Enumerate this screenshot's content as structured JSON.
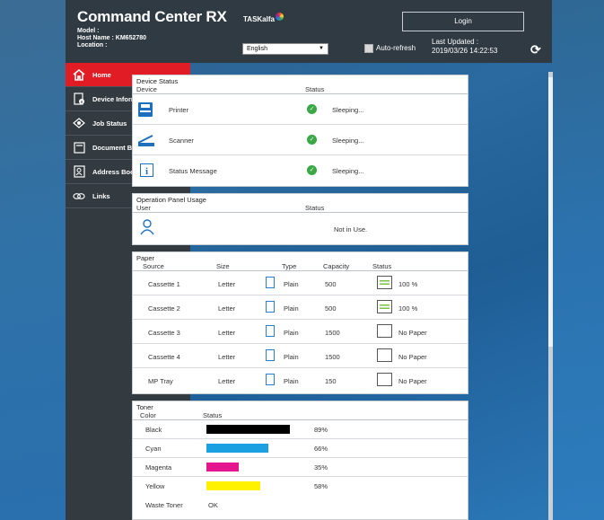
{
  "header": {
    "app_title": "Command Center RX",
    "model_label": "Model :",
    "model_value": "",
    "host_label": "Host Name : KM652780",
    "location_label": "Location :",
    "brand": "TASKalfa",
    "language": "English",
    "auto_refresh": "Auto-refresh",
    "login": "Login",
    "last_updated_label": "Last Updated :",
    "last_updated_value": "2019/03/26 14:22:53"
  },
  "sidebar": {
    "items": [
      {
        "label": "Home",
        "icon": "home-icon",
        "active": true
      },
      {
        "label": "Device Information",
        "icon": "device-info-icon"
      },
      {
        "label": "Job Status",
        "icon": "job-status-icon"
      },
      {
        "label": "Document Box",
        "icon": "document-box-icon"
      },
      {
        "label": "Address Book",
        "icon": "address-book-icon"
      },
      {
        "label": "Links",
        "icon": "links-icon"
      }
    ]
  },
  "device_status": {
    "title": "Device Status",
    "col_device": "Device",
    "col_status": "Status",
    "rows": [
      {
        "device": "Printer",
        "icon": "printer-icon",
        "status": "Sleeping..."
      },
      {
        "device": "Scanner",
        "icon": "scanner-icon",
        "status": "Sleeping..."
      },
      {
        "device": "Status Message",
        "icon": "info-icon",
        "status": "Sleeping..."
      }
    ]
  },
  "panel_usage": {
    "title": "Operation Panel Usage",
    "col_user": "User",
    "col_status": "Status",
    "status": "Not in Use."
  },
  "paper": {
    "title": "Paper",
    "cols": {
      "source": "Source",
      "size": "Size",
      "type": "Type",
      "capacity": "Capacity",
      "status": "Status"
    },
    "rows": [
      {
        "source": "Cassette 1",
        "size": "Letter",
        "type": "Plain",
        "capacity": "500",
        "status": "100 %",
        "level": 1.0
      },
      {
        "source": "Cassette 2",
        "size": "Letter",
        "type": "Plain",
        "capacity": "500",
        "status": "100 %",
        "level": 1.0
      },
      {
        "source": "Cassette 3",
        "size": "Letter",
        "type": "Plain",
        "capacity": "1500",
        "status": "No Paper",
        "level": 0
      },
      {
        "source": "Cassette 4",
        "size": "Letter",
        "type": "Plain",
        "capacity": "1500",
        "status": "No Paper",
        "level": 0
      },
      {
        "source": "MP Tray",
        "size": "Letter",
        "type": "Plain",
        "capacity": "150",
        "status": "No Paper",
        "level": 0
      }
    ]
  },
  "toner": {
    "title": "Toner",
    "col_color": "Color",
    "col_status": "Status",
    "rows": [
      {
        "color": "Black",
        "percent": "89%",
        "level": 0.89,
        "swatch": "#000000"
      },
      {
        "color": "Cyan",
        "percent": "66%",
        "level": 0.66,
        "swatch": "#1ba0e2"
      },
      {
        "color": "Magenta",
        "percent": "35%",
        "level": 0.35,
        "swatch": "#e5158f"
      },
      {
        "color": "Yellow",
        "percent": "58%",
        "level": 0.58,
        "swatch": "#fff200"
      }
    ],
    "waste_label": "Waste Toner",
    "waste_status": "OK"
  }
}
